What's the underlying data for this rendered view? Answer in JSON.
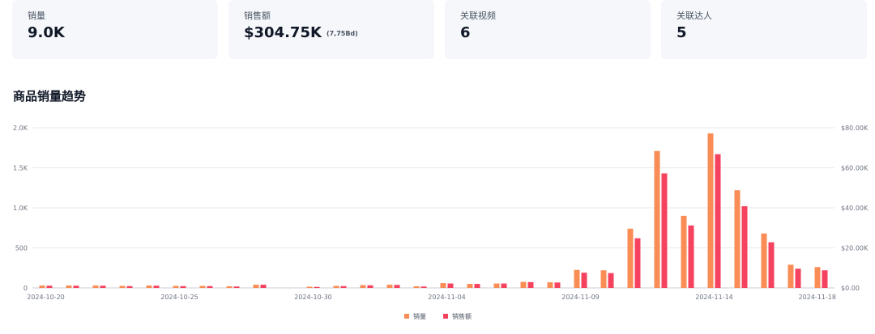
{
  "stats": [
    {
      "label": "销量",
      "value": "9.0K",
      "sub": ""
    },
    {
      "label": "销售额",
      "value": "$304.75K",
      "sub": "(7,75Bd)"
    },
    {
      "label": "关联视频",
      "value": "6",
      "sub": ""
    },
    {
      "label": "关联达人",
      "value": "5",
      "sub": ""
    }
  ],
  "section_title": "商品销量趋势",
  "chart_data": {
    "type": "bar",
    "x_ticks": [
      "2024-10-20",
      "2024-10-25",
      "2024-10-30",
      "2024-11-04",
      "2024-11-09",
      "2024-11-14",
      "2024-11-18"
    ],
    "categories": [
      "2024-10-20",
      "2024-10-21",
      "2024-10-22",
      "2024-10-23",
      "2024-10-24",
      "2024-10-25",
      "2024-10-26",
      "2024-10-27",
      "2024-10-28",
      "2024-10-29",
      "2024-10-30",
      "2024-10-31",
      "2024-11-01",
      "2024-11-02",
      "2024-11-03",
      "2024-11-04",
      "2024-11-05",
      "2024-11-06",
      "2024-11-07",
      "2024-11-08",
      "2024-11-09",
      "2024-11-10",
      "2024-11-11",
      "2024-11-12",
      "2024-11-13",
      "2024-11-14",
      "2024-11-15",
      "2024-11-16",
      "2024-11-17",
      "2024-11-18"
    ],
    "series": [
      {
        "name": "销量",
        "axis": "left",
        "color": "#f98d55",
        "values": [
          30,
          30,
          30,
          25,
          30,
          25,
          25,
          20,
          40,
          0,
          15,
          25,
          35,
          40,
          20,
          60,
          50,
          55,
          75,
          70,
          225,
          220,
          740,
          1710,
          900,
          1930,
          1220,
          680,
          290,
          260
        ]
      },
      {
        "name": "销售额",
        "axis": "right",
        "color": "#f5425f",
        "values": [
          1100,
          1100,
          1100,
          900,
          1100,
          900,
          900,
          700,
          1600,
          0,
          500,
          900,
          1300,
          1500,
          700,
          2200,
          2000,
          2200,
          2900,
          2700,
          7600,
          7400,
          24800,
          57200,
          31200,
          66800,
          40800,
          22800,
          9600,
          8800
        ]
      }
    ],
    "y_left": {
      "ticks": [
        "0",
        "500",
        "1.0K",
        "1.5K",
        "2.0K"
      ],
      "ylim": [
        0,
        2000
      ]
    },
    "y_right": {
      "ticks": [
        "$0.00",
        "$20.00K",
        "$40.00K",
        "$60.00K",
        "$80.00K"
      ],
      "ylim": [
        0,
        80000
      ]
    },
    "grid": true,
    "legend_position": "bottom-center"
  }
}
